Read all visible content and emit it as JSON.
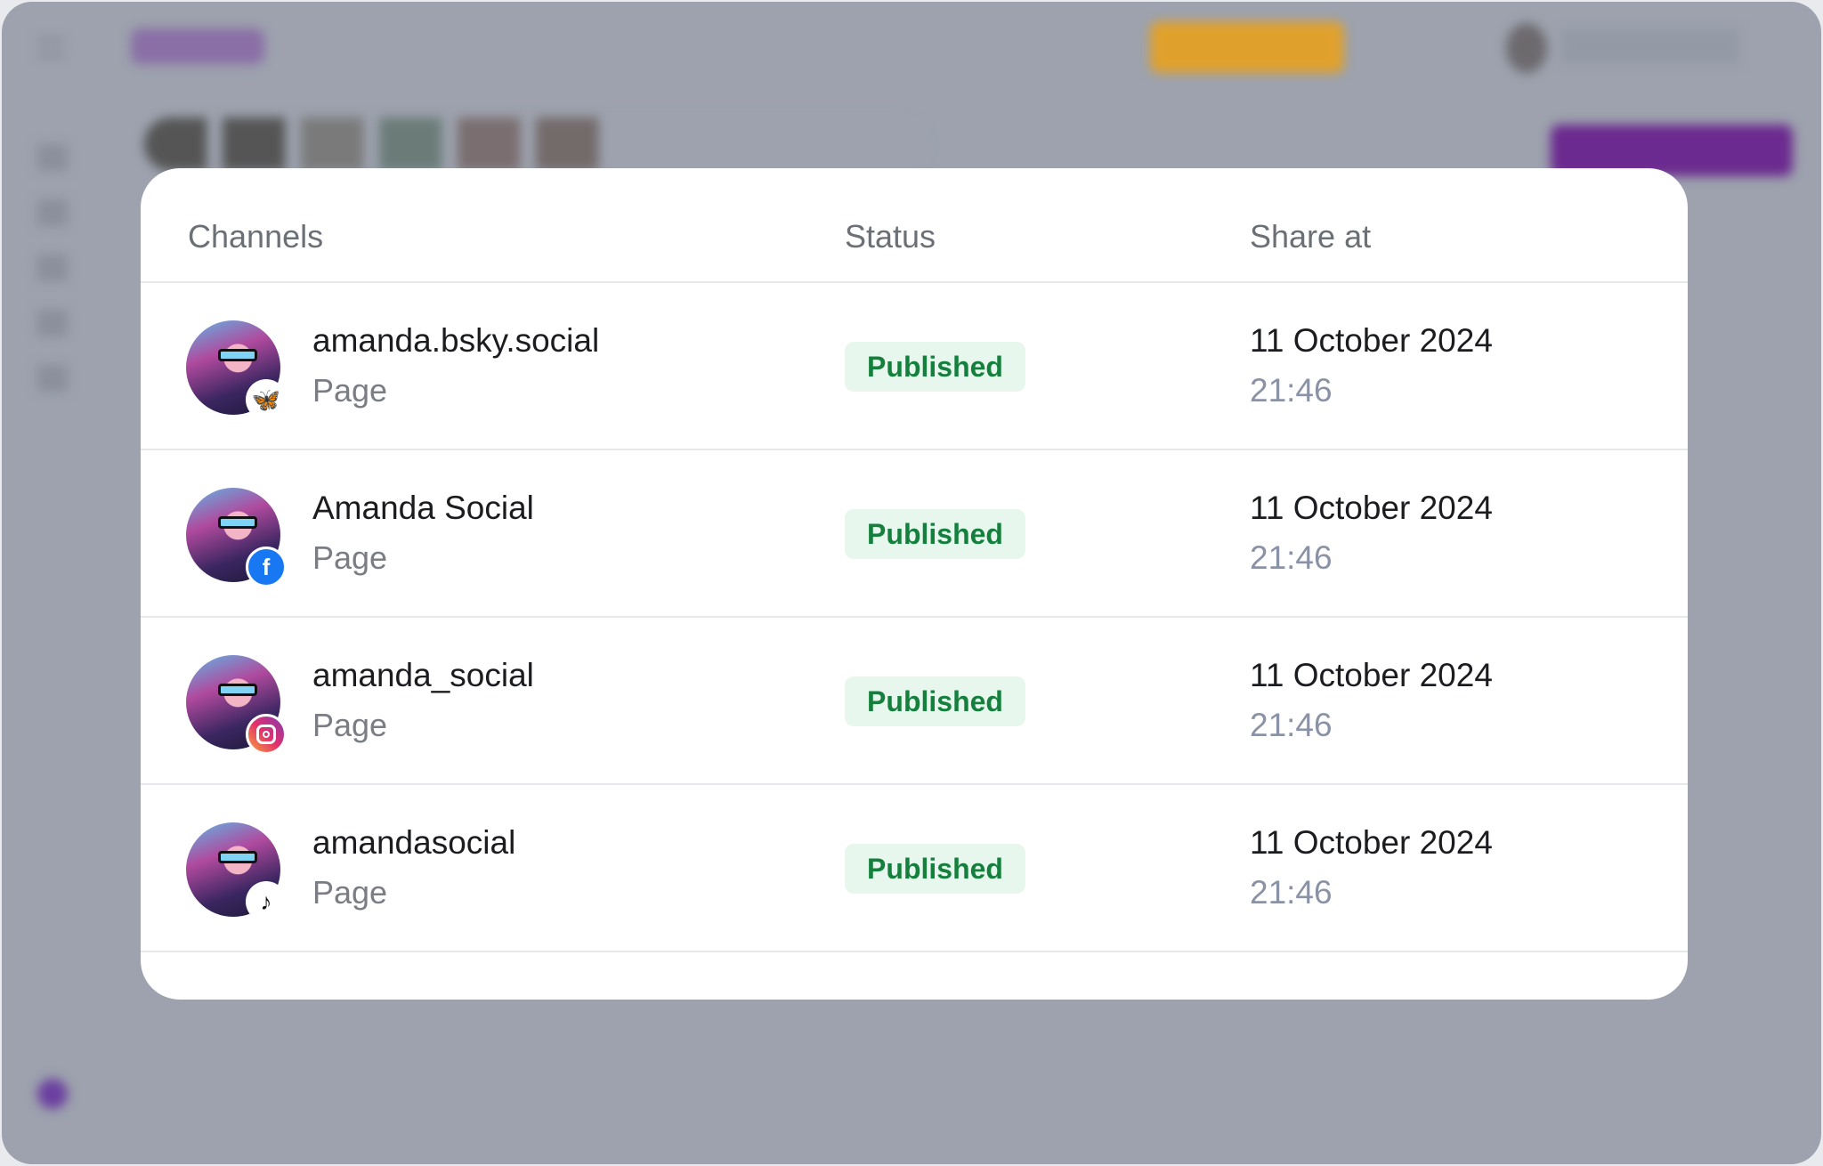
{
  "table": {
    "headers": {
      "channels": "Channels",
      "status": "Status",
      "share_at": "Share at"
    },
    "rows": [
      {
        "name": "amanda.bsky.social",
        "type": "Page",
        "network": "bluesky",
        "icon": "butterfly-icon",
        "status": "Published",
        "date": "11 October 2024",
        "time": "21:46"
      },
      {
        "name": "Amanda Social",
        "type": "Page",
        "network": "facebook",
        "icon": "facebook-icon",
        "status": "Published",
        "date": "11 October 2024",
        "time": "21:46"
      },
      {
        "name": "amanda_social",
        "type": "Page",
        "network": "instagram",
        "icon": "instagram-icon",
        "status": "Published",
        "date": "11 October 2024",
        "time": "21:46"
      },
      {
        "name": "amandasocial",
        "type": "Page",
        "network": "tiktok",
        "icon": "tiktok-icon",
        "status": "Published",
        "date": "11 October 2024",
        "time": "21:46"
      }
    ]
  },
  "colors": {
    "accent": "#6b2a8f",
    "upgrade": "#e0a12c",
    "published_bg": "#e8f7ee",
    "published_text": "#15803d"
  }
}
